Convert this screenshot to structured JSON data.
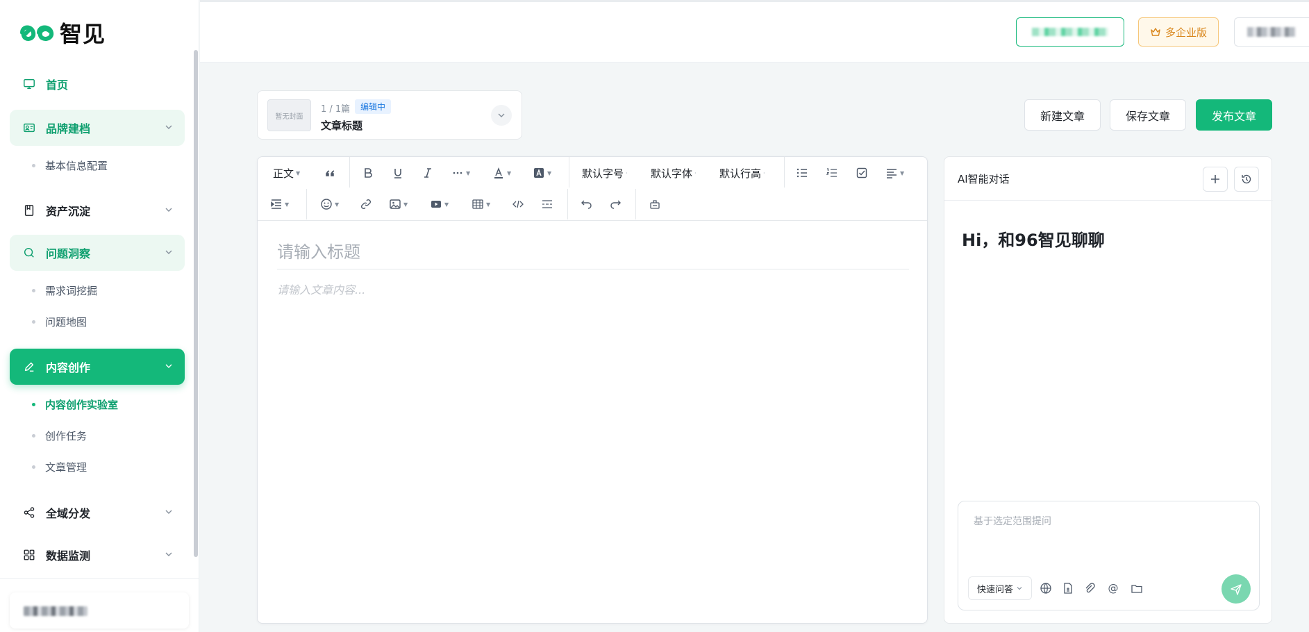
{
  "brand": {
    "logo_mark": "96",
    "logo_text": "智见",
    "accent": "#14b87a"
  },
  "sidebar": {
    "items": [
      {
        "label": "首页",
        "icon": "monitor-icon"
      },
      {
        "label": "品牌建档",
        "icon": "profile-card-icon",
        "children": [
          "基本信息配置"
        ]
      },
      {
        "label": "资产沉淀",
        "icon": "book-icon"
      },
      {
        "label": "问题洞察",
        "icon": "search-icon",
        "children": [
          "需求词挖掘",
          "问题地图"
        ]
      },
      {
        "label": "内容创作",
        "icon": "pen-icon",
        "children": [
          "内容创作实验室",
          "创作任务",
          "文章管理"
        ],
        "active_child": "内容创作实验室"
      },
      {
        "label": "全域分发",
        "icon": "share-icon"
      },
      {
        "label": "数据监测",
        "icon": "grid-icon"
      }
    ]
  },
  "topbar": {
    "vip_label": "多企业版"
  },
  "article": {
    "cover_placeholder": "暂无封面",
    "count": "1 / 1篇",
    "status": "编辑中",
    "title": "文章标题"
  },
  "actions": {
    "new": "新建文章",
    "save": "保存文章",
    "publish": "发布文章"
  },
  "editor": {
    "toolbar": {
      "paragraph": "正文",
      "font_size": "默认字号",
      "font_family": "默认字体",
      "line_height": "默认行高"
    },
    "title_placeholder": "请输入标题",
    "body_placeholder": "请输入文章内容..."
  },
  "ai": {
    "title": "AI智能对话",
    "greeting": "Hi，和96智见聊聊",
    "input_placeholder": "基于选定范围提问",
    "quick_mode": "快速问答"
  }
}
